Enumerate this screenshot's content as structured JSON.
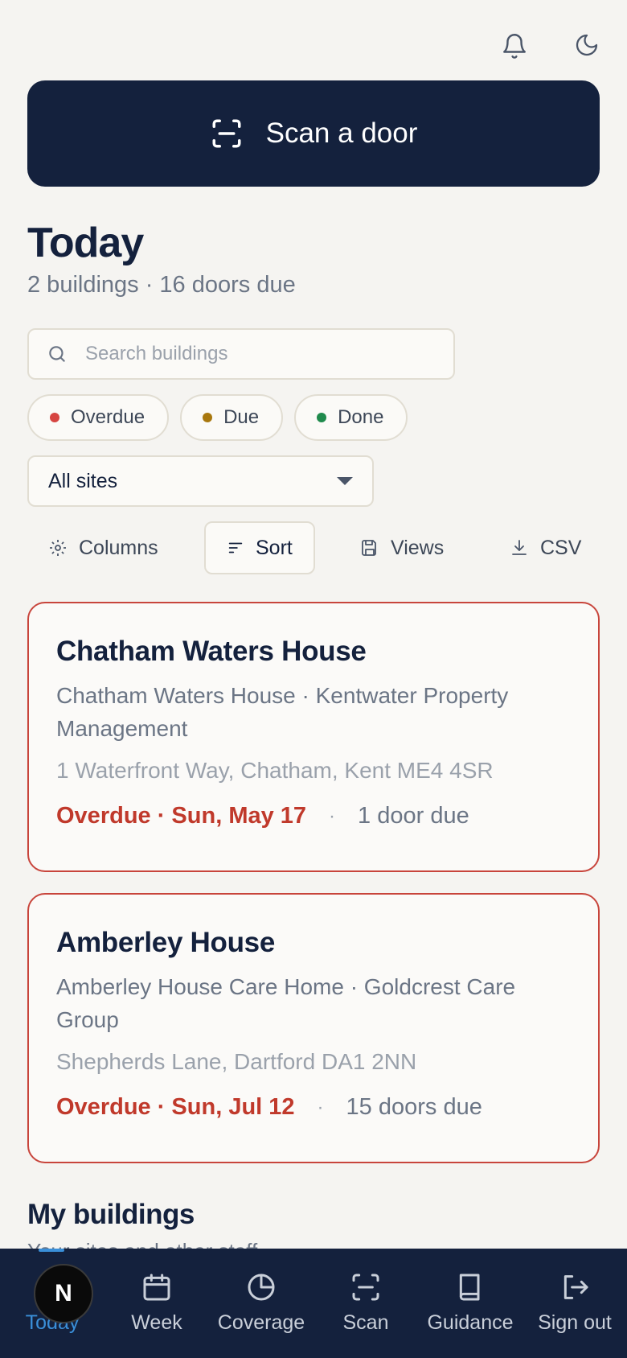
{
  "header": {
    "icons": [
      "bell-icon",
      "moon-icon"
    ]
  },
  "scan_button": {
    "label": "Scan a door",
    "icon": "scan-icon"
  },
  "page": {
    "title": "Today",
    "subtitle": "2 buildings · 16 doors due"
  },
  "search": {
    "placeholder": "Search buildings",
    "value": ""
  },
  "filters": [
    {
      "label": "Overdue",
      "color": "#d64541"
    },
    {
      "label": "Due",
      "color": "#a8770d"
    },
    {
      "label": "Done",
      "color": "#1f8a4c"
    }
  ],
  "site_select": {
    "selected": "All sites"
  },
  "toolbar": {
    "columns": "Columns",
    "sort": "Sort",
    "views": "Views",
    "csv": "CSV"
  },
  "buildings": [
    {
      "name": "Chatham Waters House",
      "org": "Chatham Waters House · Kentwater Property Management",
      "address": "1 Waterfront Way, Chatham, Kent ME4 4SR",
      "status": "Overdue · Sun, May 17",
      "doors": "1 door due"
    },
    {
      "name": "Amberley House",
      "org": "Amberley House Care Home · Goldcrest Care Group",
      "address": "Shepherds Lane, Dartford DA1 2NN",
      "status": "Overdue · Sun, Jul 12",
      "doors": "15 doors due"
    }
  ],
  "my_buildings": {
    "title": "My buildings",
    "subtitle": "Your sites and other staff"
  },
  "nav": [
    {
      "label": "Today",
      "icon": "home-icon"
    },
    {
      "label": "Week",
      "icon": "calendar-icon"
    },
    {
      "label": "Coverage",
      "icon": "pie-chart-icon"
    },
    {
      "label": "Scan",
      "icon": "scan-icon"
    },
    {
      "label": "Guidance",
      "icon": "book-icon"
    },
    {
      "label": "Sign out",
      "icon": "sign-out-icon"
    }
  ],
  "avatar": {
    "initial": "N"
  },
  "colors": {
    "navy": "#14213d",
    "overdue_red": "#c0392b",
    "accent_blue": "#3a8fd9",
    "background": "#f5f4f1"
  }
}
